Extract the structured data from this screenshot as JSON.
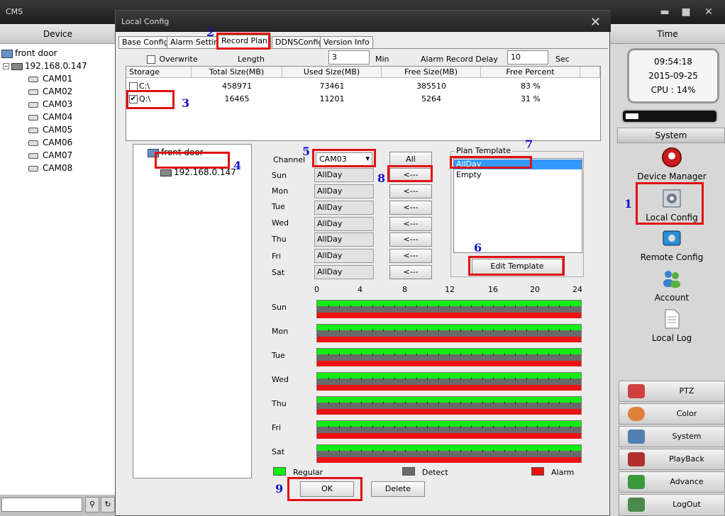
{
  "app": {
    "title": "CMS"
  },
  "left": {
    "header": "Device",
    "tree": {
      "root": "front door",
      "host": "192.168.0.147",
      "cams": [
        "CAM01",
        "CAM02",
        "CAM03",
        "CAM04",
        "CAM05",
        "CAM06",
        "CAM07",
        "CAM08"
      ]
    }
  },
  "right": {
    "header": "Time",
    "clock": {
      "time": "09:54:18",
      "date": "2015-09-25",
      "cpu": "CPU : 14%"
    },
    "cpu_fraction": 0.14,
    "system_label": "System",
    "nav": [
      "Device Manager",
      "Local Config",
      "Remote Config",
      "Account",
      "Local Log"
    ],
    "bottom": [
      "PTZ",
      "Color",
      "System",
      "PlayBack",
      "Advance",
      "LogOut"
    ]
  },
  "dialog": {
    "title": "Local Config",
    "tabs": [
      "Base Config",
      "Alarm Setting",
      "Record Plan",
      "DDNSConfig",
      "Version Info"
    ],
    "overwrite_label": "Overwrite",
    "length_label": "Length",
    "length_value": "3",
    "length_unit": "Min",
    "alarm_delay_label": "Alarm Record Delay",
    "alarm_delay_value": "10",
    "alarm_delay_unit": "Sec",
    "table": {
      "headers": [
        "Storage",
        "Total Size(MB)",
        "Used Size(MB)",
        "Free Size(MB)",
        "Free Percent"
      ],
      "rows": [
        {
          "drive": "C:\\",
          "checked": false,
          "total": "458971",
          "used": "73461",
          "free": "385510",
          "pct": "83 %"
        },
        {
          "drive": "Q:\\",
          "checked": true,
          "total": "16465",
          "used": "11201",
          "free": "5264",
          "pct": "31 %"
        }
      ]
    },
    "tree": {
      "root": "front door",
      "host": "192.168.0.147"
    },
    "channel_label": "Channel",
    "channel_value": "CAM03",
    "all_label": "All",
    "arrow_label": "<---",
    "days": [
      "Sun",
      "Mon",
      "Tue",
      "Wed",
      "Thu",
      "Fri",
      "Sat"
    ],
    "day_values": [
      "AllDay",
      "AllDay",
      "AllDay",
      "AllDay",
      "AllDay",
      "AllDay",
      "AllDay"
    ],
    "plan_template_label": "Plan Template",
    "plan_items": [
      "AllDay",
      "Empty"
    ],
    "edit_template_label": "Edit Template",
    "ruler": [
      "0",
      "4",
      "8",
      "12",
      "16",
      "20",
      "24"
    ],
    "legend": [
      {
        "label": "Regular",
        "color": "#11ee11"
      },
      {
        "label": "Detect",
        "color": "#6a6a6a"
      },
      {
        "label": "Alarm",
        "color": "#ee1111"
      }
    ],
    "ok_label": "OK",
    "delete_label": "Delete"
  },
  "annotations": [
    "1",
    "2",
    "3",
    "4",
    "5",
    "6",
    "7",
    "8",
    "9"
  ]
}
